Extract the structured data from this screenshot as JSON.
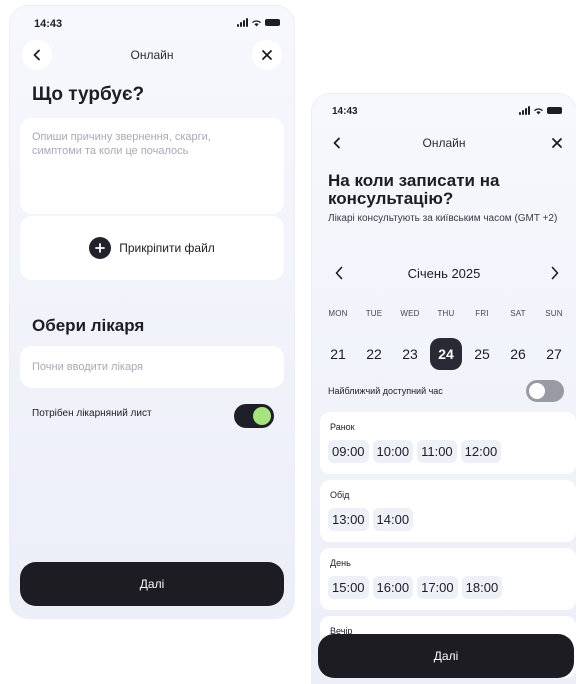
{
  "screen1": {
    "status_time": "14:43",
    "nav_title": "Онлайн",
    "heading": "Що турбує?",
    "concern_placeholder": "Опиши причину звернення, скарги, симптоми та коли це почалось",
    "attach_label": "Прикріпити файл",
    "doctor_heading": "Обери лікаря",
    "doctor_placeholder": "Почни вводити лікаря",
    "sick_note_label": "Потрібен лікарняний лист",
    "sick_note_on": true,
    "next_label": "Далі"
  },
  "screen2": {
    "status_time": "14:43",
    "nav_title": "Онлайн",
    "heading": "На коли записати на консультацію?",
    "subtitle": "Лікарі консультують за київським часом (GMT +2)",
    "month": "Січень 2025",
    "day_names": [
      "MON",
      "TUE",
      "WED",
      "THU",
      "FRI",
      "SAT",
      "SUN"
    ],
    "dates": [
      "21",
      "22",
      "23",
      "24",
      "25",
      "26",
      "27"
    ],
    "selected_date": "24",
    "nearest_label": "Найближчий доступний час",
    "nearest_on": false,
    "slots": [
      {
        "title": "Ранок",
        "times": [
          "09:00",
          "10:00",
          "11:00",
          "12:00"
        ]
      },
      {
        "title": "Обід",
        "times": [
          "13:00",
          "14:00"
        ]
      },
      {
        "title": "День",
        "times": [
          "15:00",
          "16:00",
          "17:00",
          "18:00"
        ]
      },
      {
        "title": "Вечір",
        "times": []
      }
    ],
    "next_label": "Далі"
  },
  "colors": {
    "toggle_knob_on": "#a7e27f",
    "dark": "#1c1c22",
    "chip_bg": "#eef0f8"
  }
}
